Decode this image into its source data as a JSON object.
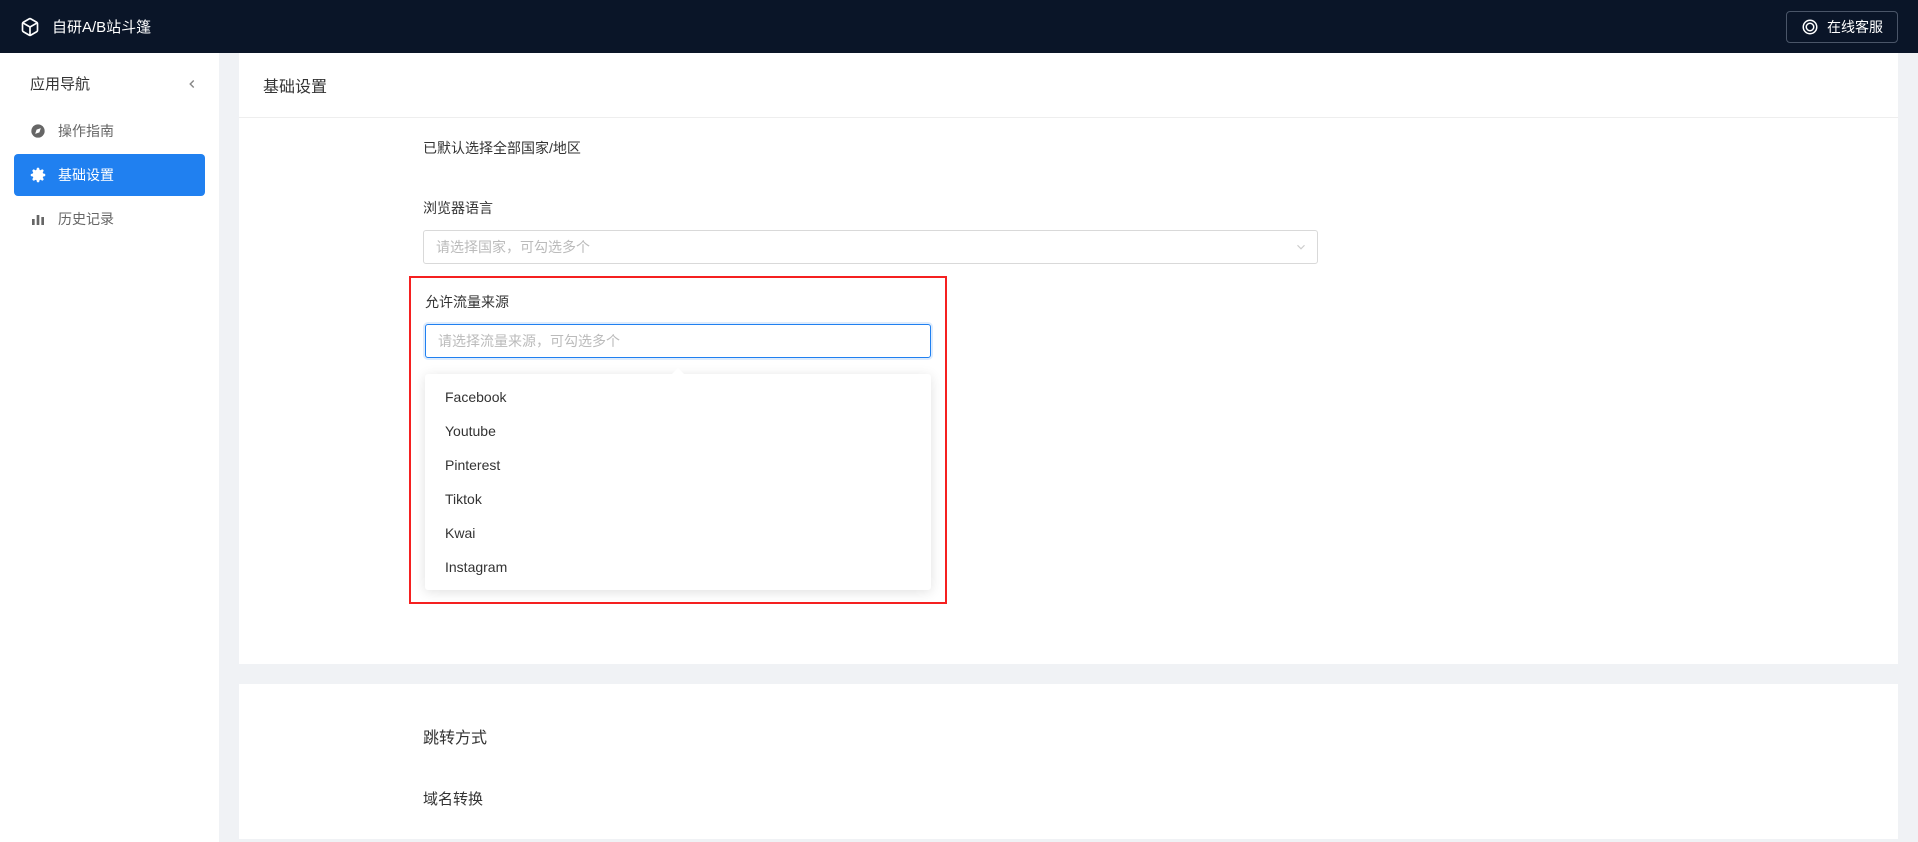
{
  "header": {
    "app_title": "自研A/B站斗篷",
    "customer_service_label": "在线客服"
  },
  "sidebar": {
    "title": "应用导航",
    "items": [
      {
        "label": "操作指南",
        "icon": "compass",
        "active": false
      },
      {
        "label": "基础设置",
        "icon": "gear",
        "active": true
      },
      {
        "label": "历史记录",
        "icon": "chart",
        "active": false
      }
    ]
  },
  "main": {
    "card_title": "基础设置",
    "default_country_text": "已默认选择全部国家/地区",
    "browser_lang": {
      "label": "浏览器语言",
      "placeholder": "请选择国家，可勾选多个"
    },
    "allow_traffic_source": {
      "label": "允许流量来源",
      "placeholder": "请选择流量来源，可勾选多个",
      "options": [
        "Facebook",
        "Youtube",
        "Pinterest",
        "Tiktok",
        "Kwai",
        "Instagram"
      ]
    },
    "redirect_method_title": "跳转方式",
    "domain_convert_title": "域名转换"
  }
}
